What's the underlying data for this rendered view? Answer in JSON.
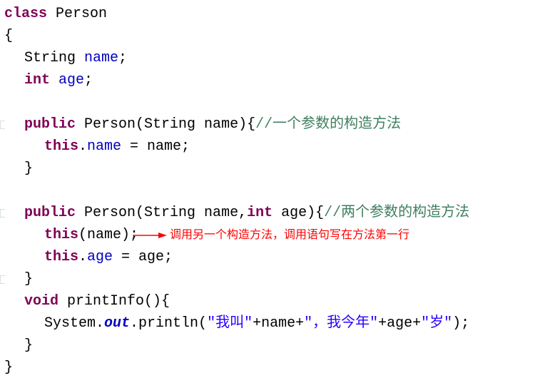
{
  "code": {
    "l1": {
      "kw": "class",
      "name": "Person"
    },
    "l2": "{",
    "l3": {
      "type": "String",
      "name": "name",
      "semi": ";"
    },
    "l4": {
      "type": "int",
      "name": "age",
      "semi": ";"
    },
    "l6": {
      "pub": "public",
      "ctor": "Person(String name){",
      "comment": "//一个参数的构造方法"
    },
    "l7": {
      "thiskw": "this",
      "dot": ".",
      "field": "name",
      "rest": " = name;"
    },
    "l8": "}",
    "l10": {
      "pub": "public",
      "ctor": "Person(String name,",
      "inttype": "int",
      "rest": " age){",
      "comment": "//两个参数的构造方法"
    },
    "l11": {
      "thiskw": "this",
      "rest": "(name);"
    },
    "l12": {
      "thiskw": "this",
      "dot": ".",
      "field": "age",
      "rest": " = age;"
    },
    "l13": "}",
    "l14": {
      "voidkw": "void",
      "rest": " printInfo(){"
    },
    "l15": {
      "sys": "System.",
      "out": "out",
      "print": ".println(",
      "s1": "\"我叫\"",
      "p1": "+name+",
      "s2": "\"，我今年\"",
      "p2": "+age+",
      "s3": "\"岁\"",
      "end": ");"
    },
    "l16": "}",
    "l17": "}"
  },
  "annotation": {
    "arrow": "→",
    "text": "调用另一个构造方法，调用语句写在方法第一行"
  }
}
